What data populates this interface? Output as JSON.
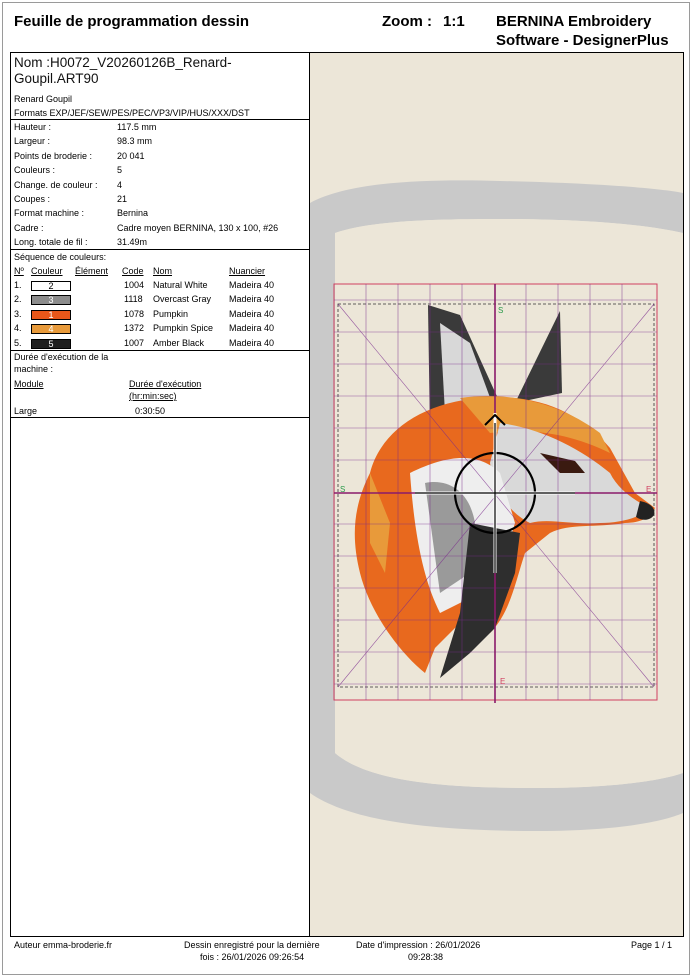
{
  "header": {
    "title": "Feuille de programmation dessin",
    "zoom_label": "Zoom :",
    "zoom_value": "1:1",
    "software_line1": "BERNINA Embroidery",
    "software_line2": "Software - DesignerPlus"
  },
  "design": {
    "name_line1": "Nom :H0072_V20260126B_Renard-",
    "name_line2": "Goupil.ART90",
    "description": "Renard Goupil",
    "formats": "Formats EXP/JEF/SEW/PES/PEC/VP3/VIP/HUS/XXX/DST"
  },
  "properties": [
    {
      "label": "Hauteur :",
      "value": "117.5 mm"
    },
    {
      "label": "Largeur :",
      "value": "98.3 mm"
    },
    {
      "label": "Points de broderie :",
      "value": "20 041"
    },
    {
      "label": "Couleurs :",
      "value": "5"
    },
    {
      "label": "Change. de couleur :",
      "value": "4"
    },
    {
      "label": "Coupes :",
      "value": "21"
    },
    {
      "label": "Format machine :",
      "value": "Bernina"
    },
    {
      "label": "Cadre :",
      "value": "Cadre moyen BERNINA, 130 x 100, #26"
    },
    {
      "label": "Long. totale de fil :",
      "value": "31.49m"
    }
  ],
  "colors_section": {
    "title": "Séquence de couleurs:",
    "headers": {
      "no": "Nº",
      "color": "Couleur",
      "element": "Élément",
      "code": "Code",
      "name": "Nom",
      "supplier": "Nuancier"
    },
    "rows": [
      {
        "idx": "1.",
        "swatch": "2",
        "hex": "#ffffff",
        "text_color": "#000000",
        "code": "1004",
        "name": "Natural White",
        "supplier": "Madeira 40"
      },
      {
        "idx": "2.",
        "swatch": "3",
        "hex": "#8c8c8c",
        "text_color": "#ffffff",
        "code": "1118",
        "name": "Overcast Gray",
        "supplier": "Madeira 40"
      },
      {
        "idx": "3.",
        "swatch": "1",
        "hex": "#e8571a",
        "text_color": "#ffffff",
        "code": "1078",
        "name": "Pumpkin",
        "supplier": "Madeira 40"
      },
      {
        "idx": "4.",
        "swatch": "4",
        "hex": "#e89a3a",
        "text_color": "#ffffff",
        "code": "1372",
        "name": "Pumpkin Spice",
        "supplier": "Madeira 40"
      },
      {
        "idx": "5.",
        "swatch": "5",
        "hex": "#1e1e1e",
        "text_color": "#ffffff",
        "code": "1007",
        "name": "Amber Black",
        "supplier": "Madeira 40"
      }
    ]
  },
  "runtime": {
    "title_line1": "Durée d'exécution de la",
    "title_line2": "machine :",
    "module_header": "Module",
    "duration_header_line1": "Durée d'exécution",
    "duration_header_line2": "(hr:min:sec)",
    "module": "Large",
    "duration": "0:30:50"
  },
  "preview": {
    "background": "#ece6d8",
    "hoop_color": "#c8c8c8",
    "grid_color": "#7a2a8c",
    "axis_color": "#8a1a6a",
    "box_color": "#d04060",
    "marker_s": "S",
    "marker_e": "E"
  },
  "footer": {
    "author": "Auteur emma-broderie.fr",
    "saved_line1": "Dessin enregistré pour la dernière",
    "saved_line2": "fois : 26/01/2026 09:26:54",
    "print_line1": "Date d'impression : 26/01/2026",
    "print_line2": "09:28:38",
    "page": "Page 1 / 1"
  }
}
